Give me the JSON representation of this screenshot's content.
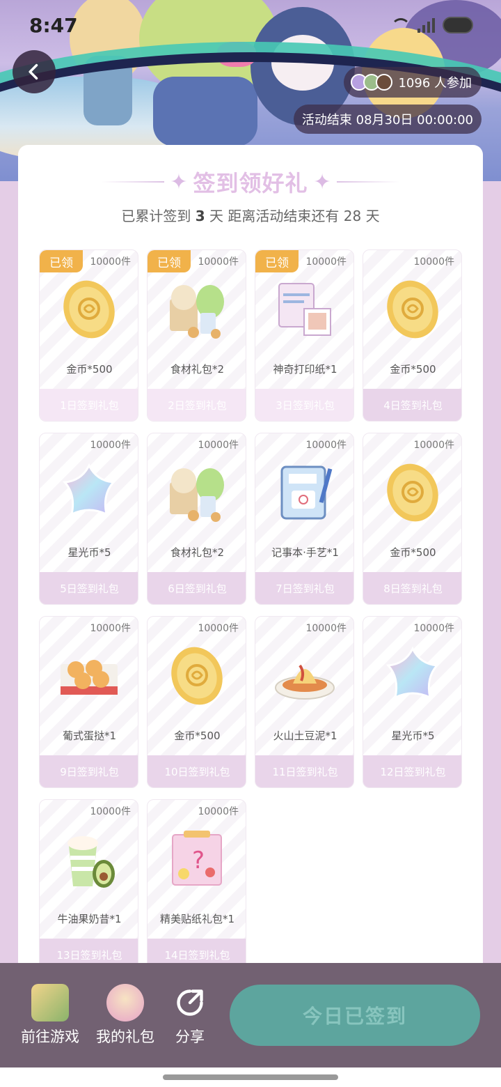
{
  "status_bar": {
    "time": "8:47"
  },
  "banner": {
    "participants_label": "1096 人参加",
    "deadline_label": "活动结束 08月30日 00:00:00"
  },
  "card": {
    "title": "签到领好礼",
    "subtitle_prefix": "已累计签到",
    "signed_days": "3",
    "subtitle_mid": "天  距离活动结束还有 28 天"
  },
  "claimed_badge": "已领",
  "days": [
    {
      "qty": "10000件",
      "name": "金币*500",
      "label": "1日签到礼包",
      "claimed": true,
      "icon": "gold-coin-icon"
    },
    {
      "qty": "10000件",
      "name": "食材礼包*2",
      "label": "2日签到礼包",
      "claimed": true,
      "icon": "ingredient-pack-icon"
    },
    {
      "qty": "10000件",
      "name": "神奇打印纸*1",
      "label": "3日签到礼包",
      "claimed": true,
      "icon": "magic-paper-icon"
    },
    {
      "qty": "10000件",
      "name": "金币*500",
      "label": "4日签到礼包",
      "claimed": false,
      "icon": "gold-coin-icon"
    },
    {
      "qty": "10000件",
      "name": "星光币*5",
      "label": "5日签到礼包",
      "claimed": false,
      "icon": "starlight-coin-icon"
    },
    {
      "qty": "10000件",
      "name": "食材礼包*2",
      "label": "6日签到礼包",
      "claimed": false,
      "icon": "ingredient-pack-icon"
    },
    {
      "qty": "10000件",
      "name": "记事本·手艺*1",
      "label": "7日签到礼包",
      "claimed": false,
      "icon": "notebook-icon"
    },
    {
      "qty": "10000件",
      "name": "金币*500",
      "label": "8日签到礼包",
      "claimed": false,
      "icon": "gold-coin-icon"
    },
    {
      "qty": "10000件",
      "name": "葡式蛋挞*1",
      "label": "9日签到礼包",
      "claimed": false,
      "icon": "egg-tart-icon"
    },
    {
      "qty": "10000件",
      "name": "金币*500",
      "label": "10日签到礼包",
      "claimed": false,
      "icon": "gold-coin-icon"
    },
    {
      "qty": "10000件",
      "name": "火山土豆泥*1",
      "label": "11日签到礼包",
      "claimed": false,
      "icon": "mashed-potato-icon"
    },
    {
      "qty": "10000件",
      "name": "星光币*5",
      "label": "12日签到礼包",
      "claimed": false,
      "icon": "starlight-coin-icon"
    },
    {
      "qty": "10000件",
      "name": "牛油果奶昔*1",
      "label": "13日签到礼包",
      "claimed": false,
      "icon": "avocado-shake-icon"
    },
    {
      "qty": "10000件",
      "name": "精美贴纸礼包*1",
      "label": "14日签到礼包",
      "claimed": false,
      "icon": "sticker-pack-icon"
    }
  ],
  "bottom_bar": {
    "go_game": "前往游戏",
    "my_gifts": "我的礼包",
    "share": "分享",
    "signed_today": "今日已签到"
  },
  "colors": {
    "claimed_badge": "#f1b24a",
    "day_label_bg": "#e9d5ea",
    "title": "#e2bfe5",
    "signed_button": "#5da59e",
    "bottom_bar": "#726172"
  }
}
